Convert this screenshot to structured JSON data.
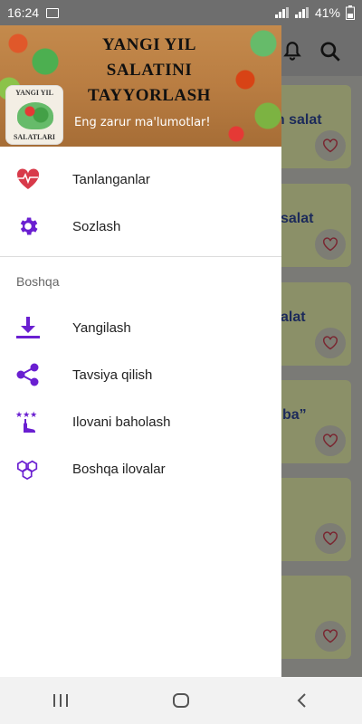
{
  "status_bar": {
    "time": "16:24",
    "battery": "41%"
  },
  "drawer": {
    "header": {
      "title_lines": [
        "YANGI YIL",
        "SALATINI",
        "TAYYORLASH"
      ],
      "subtitle": "Eng zarur ma'lumotlar!",
      "logo_top": "YANGI YIL",
      "logo_bottom": "SALATLARI"
    },
    "items": [
      {
        "label": "Tanlanganlar",
        "icon": "heart-pulse-icon"
      },
      {
        "label": "Sozlash",
        "icon": "gear-icon"
      }
    ],
    "section_label": "Boshqa",
    "other_items": [
      {
        "label": "Yangilash",
        "icon": "download-icon"
      },
      {
        "label": "Tavsiya qilish",
        "icon": "share-icon"
      },
      {
        "label": "Ilovani baholash",
        "icon": "rate-app-icon"
      },
      {
        "label": "Boshqa ilovalar",
        "icon": "hexagons-icon"
      }
    ]
  },
  "background": {
    "cards": [
      {
        "text": "an salat"
      },
      {
        "text": "salat"
      },
      {
        "text": "alat"
      },
      {
        "text": "ba”"
      },
      {
        "text": ""
      },
      {
        "text": ""
      }
    ]
  },
  "colors": {
    "accent": "#6a1fd1",
    "heart": "#d83a4a"
  }
}
